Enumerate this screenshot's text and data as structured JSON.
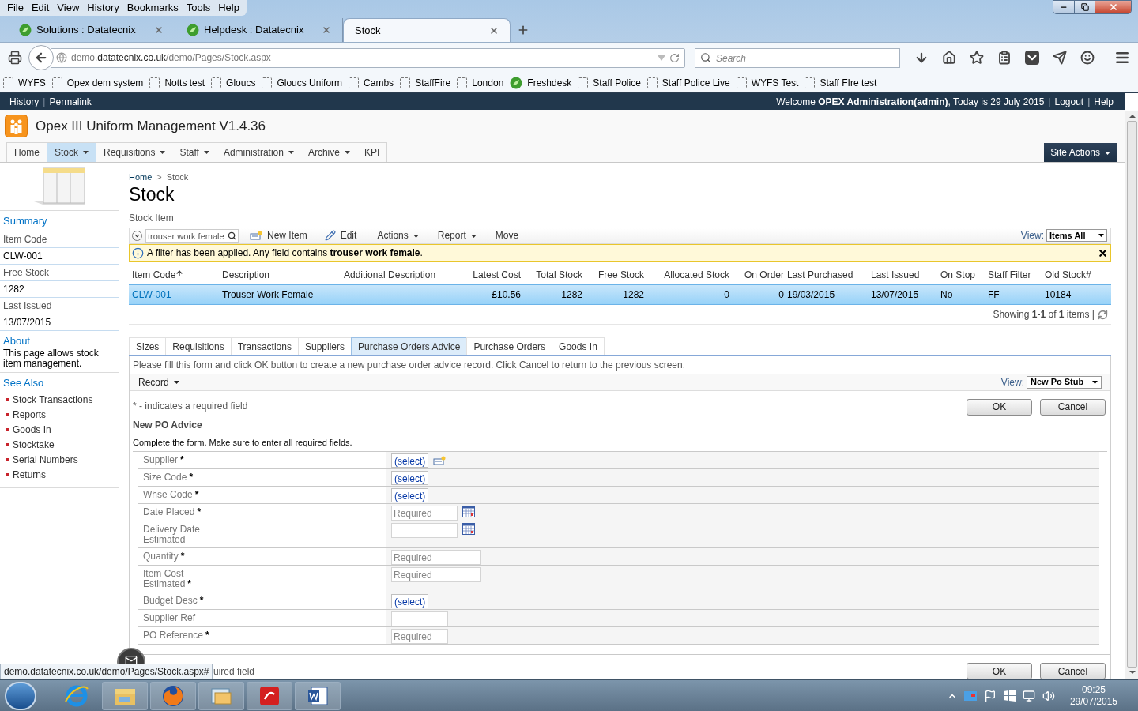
{
  "browser": {
    "menu": [
      "File",
      "Edit",
      "View",
      "History",
      "Bookmarks",
      "Tools",
      "Help"
    ],
    "tabs": [
      {
        "title": "Solutions : Datatecnix",
        "favicon": true,
        "selected": false
      },
      {
        "title": "Helpdesk : Datatecnix",
        "favicon": true,
        "selected": false
      },
      {
        "title": "Stock",
        "favicon": false,
        "selected": true
      }
    ],
    "url": {
      "prefix": "demo.",
      "domain": "datatecnix.co.uk",
      "path": "/demo/Pages/Stock.aspx"
    },
    "search_placeholder": "Search",
    "bookmarks": [
      {
        "label": "WYFS",
        "kind": "page"
      },
      {
        "label": "Opex dem system",
        "kind": "page"
      },
      {
        "label": "Notts test",
        "kind": "page"
      },
      {
        "label": "Gloucs",
        "kind": "page"
      },
      {
        "label": "Gloucs Uniform",
        "kind": "page"
      },
      {
        "label": "Cambs",
        "kind": "page"
      },
      {
        "label": "StaffFire",
        "kind": "page"
      },
      {
        "label": "London",
        "kind": "page"
      },
      {
        "label": "Freshdesk",
        "kind": "site"
      },
      {
        "label": "Staff Police",
        "kind": "page"
      },
      {
        "label": "Staff Police Live",
        "kind": "page"
      },
      {
        "label": "WYFS Test",
        "kind": "page"
      },
      {
        "label": "Staff FIre test",
        "kind": "page"
      }
    ],
    "status_url": "demo.datatecnix.co.uk/demo/Pages/Stock.aspx#"
  },
  "page": {
    "top_links": [
      "History",
      "Permalink"
    ],
    "link_separator": "|",
    "welcome": "Welcome **OPEX Administration(admin)**, Today is 29 July 2015",
    "user_links": [
      "Logout",
      "Help"
    ],
    "site_title": "Opex III Uniform Management V1.4.36",
    "nav": [
      {
        "label": "Home",
        "menu": false,
        "selected": false
      },
      {
        "label": "Stock",
        "menu": true,
        "selected": true
      },
      {
        "label": "Requisitions",
        "menu": true,
        "selected": false
      },
      {
        "label": "Staff",
        "menu": true,
        "selected": false
      },
      {
        "label": "Administration",
        "menu": true,
        "selected": false
      },
      {
        "label": "Archive",
        "menu": true,
        "selected": false
      },
      {
        "label": "KPI",
        "menu": false,
        "selected": false
      }
    ],
    "site_actions": "Site Actions",
    "sidebar": {
      "summary_title": "Summary",
      "summary": [
        {
          "label": "Item Code",
          "value": "CLW-001"
        },
        {
          "label": "Free Stock",
          "value": "1282"
        },
        {
          "label": "Last Issued",
          "value": "13/07/2015"
        }
      ],
      "about_title": "About",
      "about_text": "This page allows stock item management.",
      "see_also_title": "See Also",
      "links": [
        "Stock Transactions",
        "Reports",
        "Goods In",
        "Stocktake",
        "Serial Numbers",
        "Returns"
      ]
    },
    "breadcrumb": [
      "Home",
      "Stock"
    ],
    "breadcrumb_separator": ">",
    "title": "Stock",
    "section": "Stock Item",
    "toolbar": {
      "search_value": "trouser work female",
      "new_item": "New Item",
      "edit": "Edit",
      "actions": "Actions",
      "report": "Report",
      "move": "Move",
      "view_label": "View:",
      "view": "Items All"
    },
    "filter_message": "A filter has been applied. Any field contains **trouser work female**.",
    "table": {
      "columns": [
        {
          "label": "Item Code",
          "kind": "text",
          "sorted": true
        },
        {
          "label": "Description",
          "kind": "text",
          "sorted": false
        },
        {
          "label": "Additional Description",
          "kind": "text",
          "sorted": false
        },
        {
          "label": "Latest Cost",
          "kind": "number",
          "sorted": false
        },
        {
          "label": "Total Stock",
          "kind": "number",
          "sorted": false
        },
        {
          "label": "Free Stock",
          "kind": "number",
          "sorted": false
        },
        {
          "label": "Allocated Stock",
          "kind": "number",
          "sorted": false
        },
        {
          "label": "On Order",
          "kind": "number",
          "sorted": false
        },
        {
          "label": "Last Purchased",
          "kind": "text",
          "sorted": false
        },
        {
          "label": "Last Issued",
          "kind": "text",
          "sorted": false
        },
        {
          "label": "On Stop",
          "kind": "text",
          "sorted": false
        },
        {
          "label": "Staff Filter",
          "kind": "text",
          "sorted": false
        },
        {
          "label": "Old Stock#",
          "kind": "text",
          "sorted": false
        }
      ],
      "rows": [
        {
          "selected": true,
          "cells": [
            "CLW-001",
            "Trouser Work Female",
            "",
            "£10.56",
            "1282",
            "1282",
            "0",
            "0",
            "19/03/2015",
            "13/07/2015",
            "No",
            "FF",
            "10184"
          ]
        }
      ],
      "footer": "Showing **1-1** of **1** items |"
    },
    "detail_tabs": [
      {
        "label": "Sizes",
        "selected": false
      },
      {
        "label": "Requisitions",
        "selected": false
      },
      {
        "label": "Transactions",
        "selected": false
      },
      {
        "label": "Suppliers",
        "selected": false
      },
      {
        "label": "Purchase Orders Advice",
        "selected": true
      },
      {
        "label": "Purchase Orders",
        "selected": false
      },
      {
        "label": "Goods In",
        "selected": false
      }
    ],
    "form": {
      "instruction": "Please fill this form and click OK button to create a new purchase order advice record. Click Cancel to return to the previous screen.",
      "record_menu": "Record",
      "view_label": "View:",
      "view": "New Po Stub",
      "required_note": "* - indicates a required field",
      "required_mark": "*",
      "ok": "OK",
      "cancel": "Cancel",
      "heading": "New PO Advice",
      "subheading": "Complete the form. Make sure to enter all required fields.",
      "fields": [
        {
          "label": [
            "Supplier"
          ],
          "required": true,
          "kind": "select",
          "text": "(select)",
          "add_icon": true
        },
        {
          "label": [
            "Size Code"
          ],
          "required": true,
          "kind": "select",
          "text": "(select)",
          "add_icon": false
        },
        {
          "label": [
            "Whse Code"
          ],
          "required": true,
          "kind": "select",
          "text": "(select)",
          "add_icon": false
        },
        {
          "label": [
            "Date Placed"
          ],
          "required": true,
          "kind": "date",
          "placeholder": "Required"
        },
        {
          "label": [
            "Delivery Date",
            "Estimated"
          ],
          "required": false,
          "kind": "date"
        },
        {
          "label": [
            "Quantity"
          ],
          "required": true,
          "kind": "text",
          "placeholder": "Required"
        },
        {
          "label": [
            "Item Cost",
            "Estimated"
          ],
          "required": true,
          "kind": "text",
          "placeholder": "Required"
        },
        {
          "label": [
            "Budget Desc"
          ],
          "required": true,
          "kind": "select",
          "text": "(select)",
          "add_icon": false
        },
        {
          "label": [
            "Supplier Ref"
          ],
          "required": false,
          "kind": "short"
        },
        {
          "label": [
            "PO Reference"
          ],
          "required": true,
          "kind": "short",
          "placeholder": "Required"
        }
      ],
      "bottom_note": "uired field",
      "bottom_ok": "OK",
      "bottom_cancel": "Cancel"
    }
  },
  "taskbar": {
    "time": "09:25",
    "date": "29/07/2015"
  }
}
